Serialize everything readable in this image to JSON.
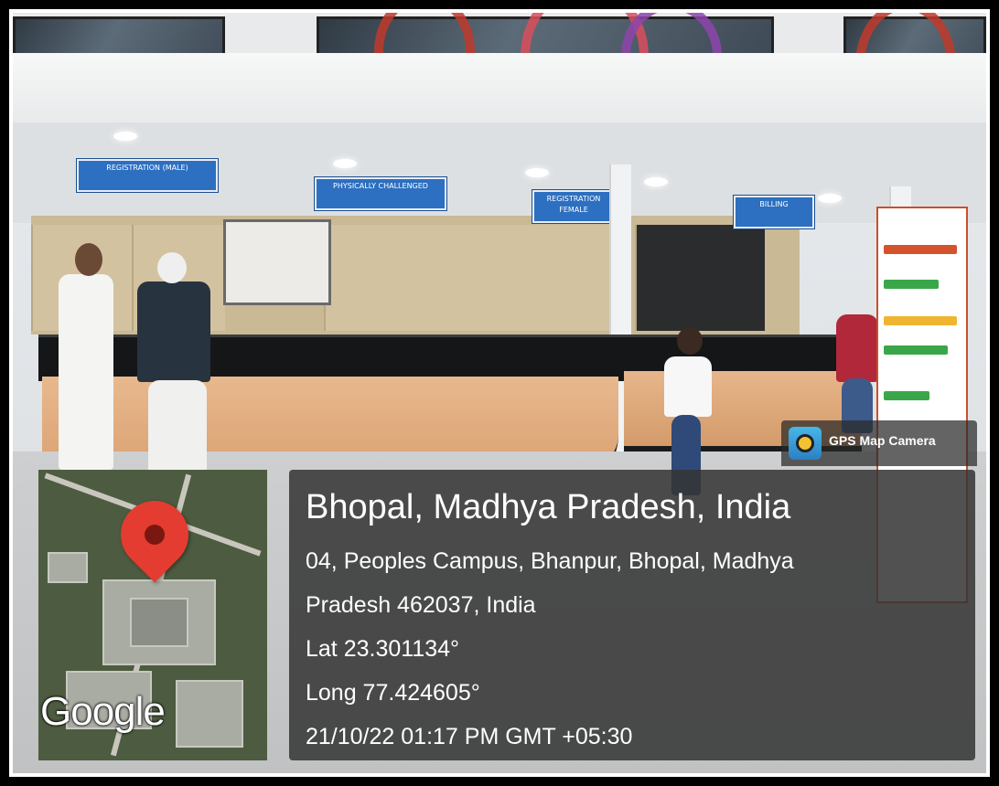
{
  "overlay": {
    "app_name": "GPS Map Camera",
    "map_brand": "Google",
    "location_title": "Bhopal, Madhya Pradesh, India",
    "address_line1": "04, Peoples Campus, Bhanpur, Bhopal, Madhya",
    "address_line2": "Pradesh 462037, India",
    "latitude": "Lat 23.301134°",
    "longitude": "Long 77.424605°",
    "timestamp": "21/10/22 01:17 PM GMT +05:30"
  },
  "signs": {
    "registration_male": "REGISTRATION (MALE)",
    "physically_challenged": "PHYSICALLY CHALLENGED",
    "registration_female": "REGISTRATION FEMALE",
    "billing": "BILLING"
  },
  "colors": {
    "pin": "#e43c30",
    "sign_blue": "#2d6fc0",
    "overlay_bg": "#343434"
  }
}
